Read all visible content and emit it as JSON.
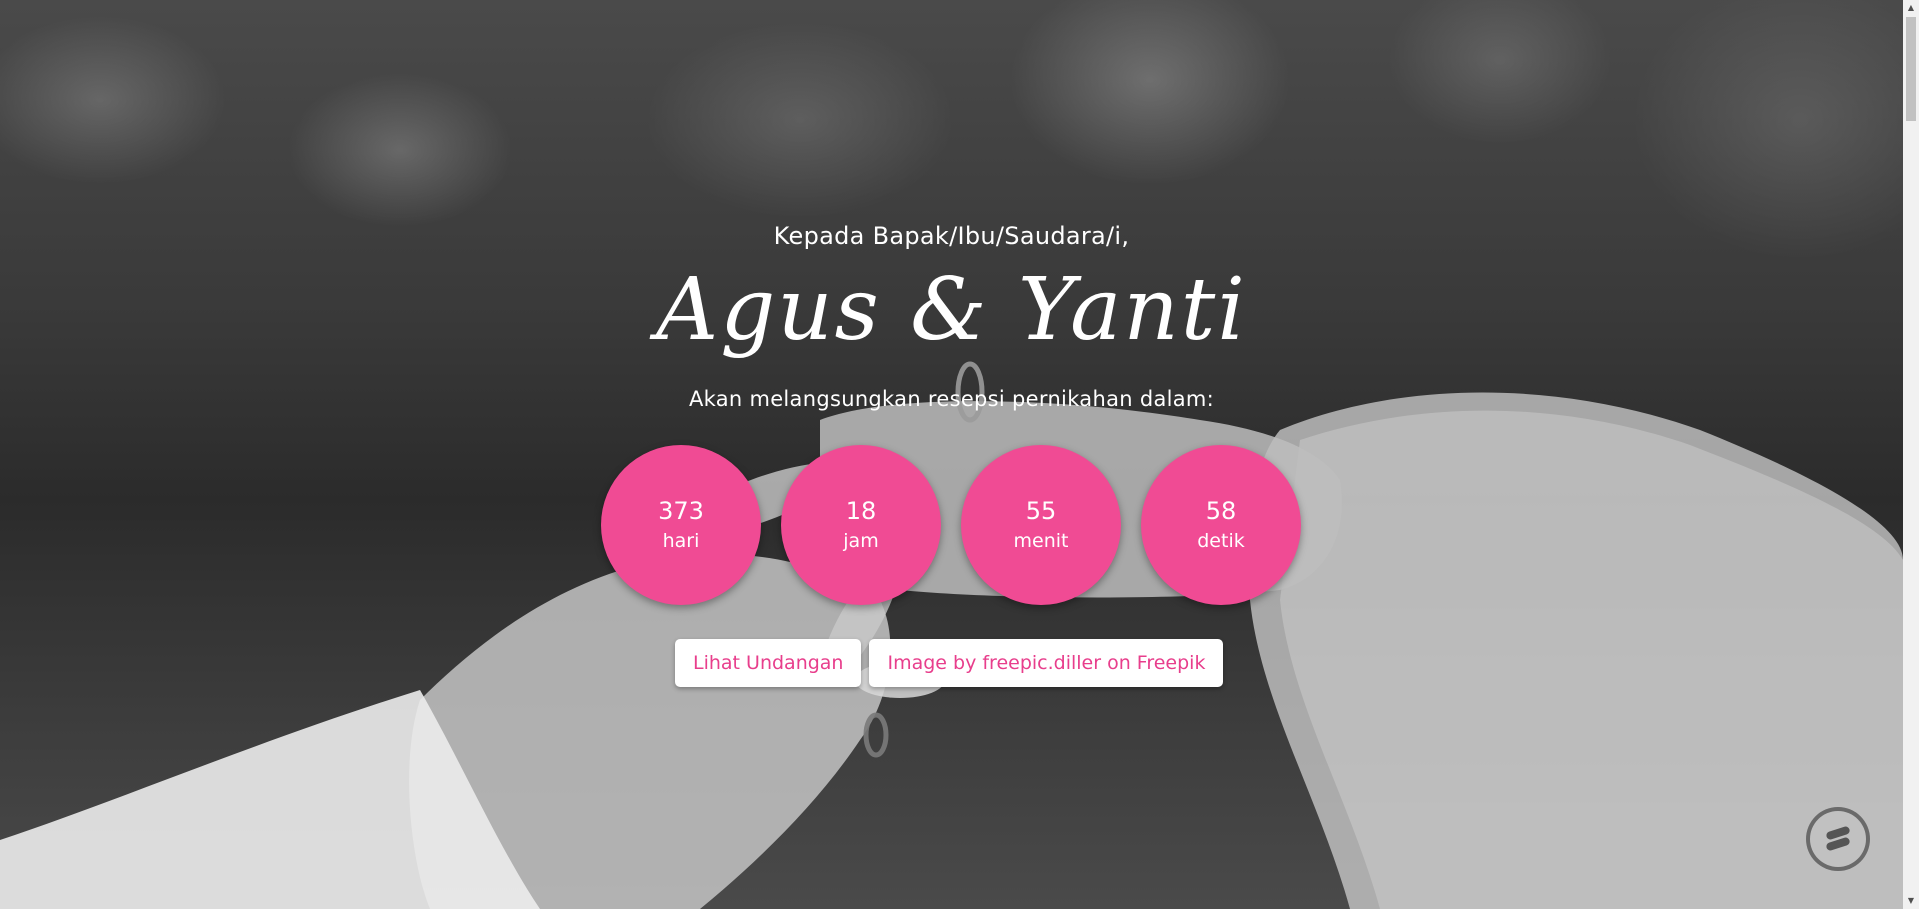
{
  "hero": {
    "greeting": "Kepada Bapak/Ibu/Saudara/i,",
    "couple_names": "Agus & Yanti",
    "subtitle": "Akan melangsungkan resepsi pernikahan dalam:"
  },
  "countdown": [
    {
      "value": "373",
      "unit": "hari"
    },
    {
      "value": "18",
      "unit": "jam"
    },
    {
      "value": "55",
      "unit": "menit"
    },
    {
      "value": "58",
      "unit": "detik"
    }
  ],
  "buttons": {
    "view_invitation": "Lihat Undangan",
    "image_credit": "Image by freepic.diller on Freepik"
  },
  "colors": {
    "accent": "#f04b94",
    "button_text": "#e83e8c",
    "text": "#ffffff"
  },
  "icons": {
    "floating_widget": "chat-widget-icon",
    "scroll_up": "scroll-up-arrow-icon",
    "scroll_down": "scroll-down-arrow-icon"
  }
}
